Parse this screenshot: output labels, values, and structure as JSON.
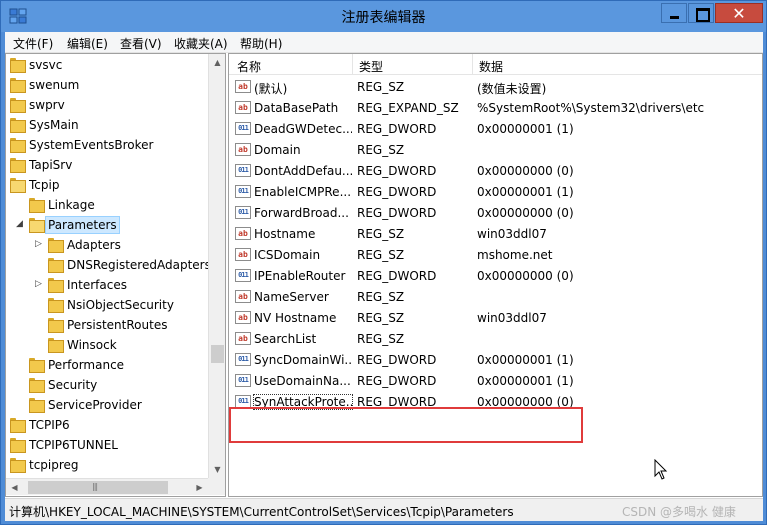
{
  "window": {
    "title": "注册表编辑器",
    "close_symbol": "✕"
  },
  "menu": [
    "文件(F)",
    "编辑(E)",
    "查看(V)",
    "收藏夹(A)",
    "帮助(H)"
  ],
  "tree": [
    {
      "label": "svsvc",
      "level": 0,
      "expander": ""
    },
    {
      "label": "swenum",
      "level": 0,
      "expander": ""
    },
    {
      "label": "swprv",
      "level": 0,
      "expander": ""
    },
    {
      "label": "SysMain",
      "level": 0,
      "expander": ""
    },
    {
      "label": "SystemEventsBroker",
      "level": 0,
      "expander": ""
    },
    {
      "label": "TapiSrv",
      "level": 0,
      "expander": ""
    },
    {
      "label": "Tcpip",
      "level": 0,
      "expander": "",
      "open": true
    },
    {
      "label": "Linkage",
      "level": 1,
      "expander": ""
    },
    {
      "label": "Parameters",
      "level": 1,
      "expander": "◢",
      "open": true,
      "selected": true
    },
    {
      "label": "Adapters",
      "level": 2,
      "expander": "▷"
    },
    {
      "label": "DNSRegisteredAdapters",
      "level": 2,
      "expander": ""
    },
    {
      "label": "Interfaces",
      "level": 2,
      "expander": "▷"
    },
    {
      "label": "NsiObjectSecurity",
      "level": 2,
      "expander": ""
    },
    {
      "label": "PersistentRoutes",
      "level": 2,
      "expander": ""
    },
    {
      "label": "Winsock",
      "level": 2,
      "expander": ""
    },
    {
      "label": "Performance",
      "level": 1,
      "expander": ""
    },
    {
      "label": "Security",
      "level": 1,
      "expander": ""
    },
    {
      "label": "ServiceProvider",
      "level": 1,
      "expander": ""
    },
    {
      "label": "TCPIP6",
      "level": 0,
      "expander": ""
    },
    {
      "label": "TCPIP6TUNNEL",
      "level": 0,
      "expander": ""
    },
    {
      "label": "tcpipreg",
      "level": 0,
      "expander": ""
    }
  ],
  "columns": {
    "name": "名称",
    "type": "类型",
    "data": "数据"
  },
  "values": [
    {
      "kind": "sz",
      "name": "(默认)",
      "type": "REG_SZ",
      "data": "(数值未设置)"
    },
    {
      "kind": "sz",
      "name": "DataBasePath",
      "type": "REG_EXPAND_SZ",
      "data": "%SystemRoot%\\System32\\drivers\\etc"
    },
    {
      "kind": "bin",
      "name": "DeadGWDetec...",
      "type": "REG_DWORD",
      "data": "0x00000001 (1)"
    },
    {
      "kind": "sz",
      "name": "Domain",
      "type": "REG_SZ",
      "data": ""
    },
    {
      "kind": "bin",
      "name": "DontAddDefau...",
      "type": "REG_DWORD",
      "data": "0x00000000 (0)"
    },
    {
      "kind": "bin",
      "name": "EnableICMPRe...",
      "type": "REG_DWORD",
      "data": "0x00000001 (1)"
    },
    {
      "kind": "bin",
      "name": "ForwardBroad...",
      "type": "REG_DWORD",
      "data": "0x00000000 (0)"
    },
    {
      "kind": "sz",
      "name": "Hostname",
      "type": "REG_SZ",
      "data": "win03ddl07"
    },
    {
      "kind": "sz",
      "name": "ICSDomain",
      "type": "REG_SZ",
      "data": "mshome.net"
    },
    {
      "kind": "bin",
      "name": "IPEnableRouter",
      "type": "REG_DWORD",
      "data": "0x00000000 (0)"
    },
    {
      "kind": "sz",
      "name": "NameServer",
      "type": "REG_SZ",
      "data": ""
    },
    {
      "kind": "sz",
      "name": "NV Hostname",
      "type": "REG_SZ",
      "data": "win03ddl07"
    },
    {
      "kind": "sz",
      "name": "SearchList",
      "type": "REG_SZ",
      "data": ""
    },
    {
      "kind": "bin",
      "name": "SyncDomainWi...",
      "type": "REG_DWORD",
      "data": "0x00000001 (1)"
    },
    {
      "kind": "bin",
      "name": "UseDomainNa...",
      "type": "REG_DWORD",
      "data": "0x00000001 (1)"
    },
    {
      "kind": "bin",
      "name": "SynAttackProte...",
      "type": "REG_DWORD",
      "data": "0x00000000 (0)",
      "focused": true
    }
  ],
  "icons": {
    "sz": "ab",
    "bin": "011"
  },
  "status": {
    "path": "计算机\\HKEY_LOCAL_MACHINE\\SYSTEM\\CurrentControlSet\\Services\\Tcpip\\Parameters"
  },
  "watermark": "CSDN @多喝水 健康",
  "colors": {
    "highlight": "#e03b3b",
    "selection": "#cde8ff",
    "titlebar": "#5a97de"
  }
}
